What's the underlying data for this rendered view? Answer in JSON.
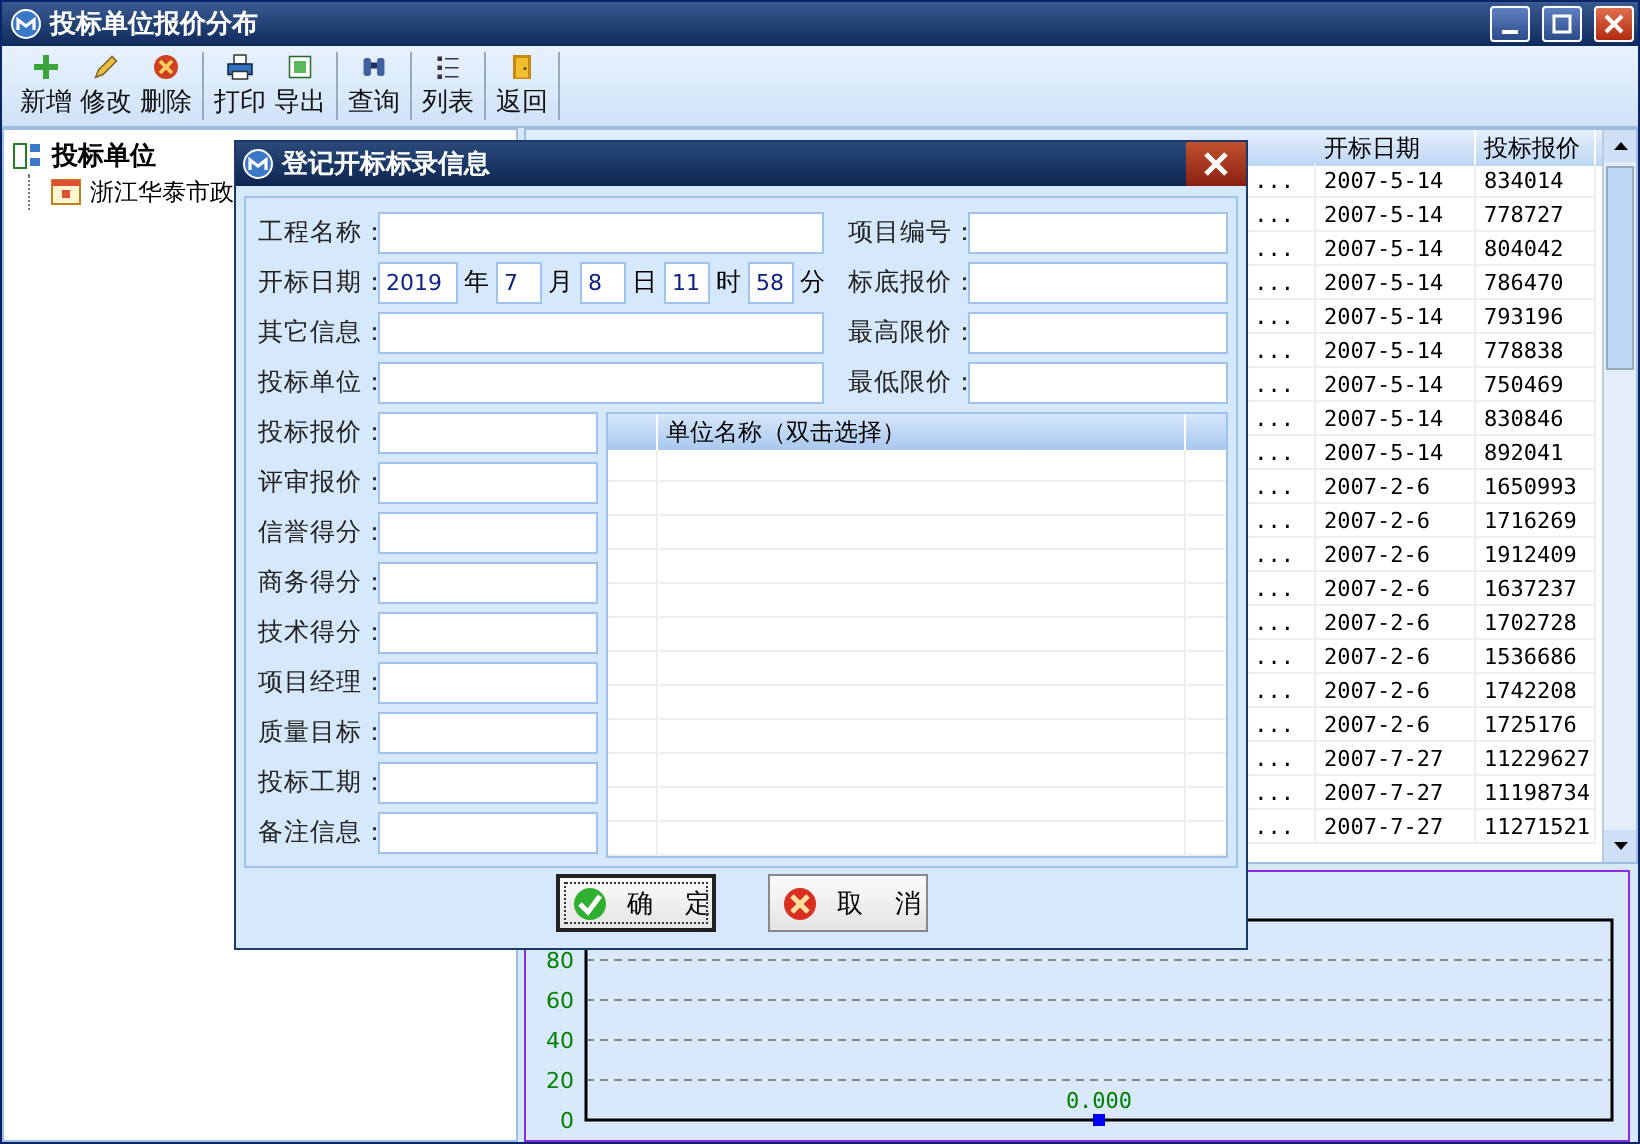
{
  "window": {
    "title": "投标单位报价分布"
  },
  "toolbar": {
    "groups": [
      {
        "buttons": [
          {
            "label": "新增"
          },
          {
            "label": "修改"
          },
          {
            "label": "删除"
          }
        ]
      },
      {
        "buttons": [
          {
            "label": "打印"
          },
          {
            "label": "导出"
          }
        ]
      },
      {
        "buttons": [
          {
            "label": "查询"
          }
        ]
      },
      {
        "buttons": [
          {
            "label": "列表"
          }
        ]
      },
      {
        "buttons": [
          {
            "label": "返回"
          }
        ]
      }
    ]
  },
  "tree": {
    "root": {
      "label": "投标单位",
      "children": [
        {
          "label": "浙江华泰市政"
        }
      ]
    }
  },
  "table": {
    "columns": [
      {
        "label": "开标日期"
      },
      {
        "label": "投标报价"
      }
    ],
    "rows": [
      {
        "project": "...",
        "date": "2007-5-14",
        "price": "834014"
      },
      {
        "project": "...",
        "date": "2007-5-14",
        "price": "778727"
      },
      {
        "project": "...",
        "date": "2007-5-14",
        "price": "804042"
      },
      {
        "project": "...",
        "date": "2007-5-14",
        "price": "786470"
      },
      {
        "project": "...",
        "date": "2007-5-14",
        "price": "793196"
      },
      {
        "project": "...",
        "date": "2007-5-14",
        "price": "778838"
      },
      {
        "project": "...",
        "date": "2007-5-14",
        "price": "750469"
      },
      {
        "project": "...",
        "date": "2007-5-14",
        "price": "830846"
      },
      {
        "project": "...",
        "date": "2007-5-14",
        "price": "892041"
      },
      {
        "project": "...",
        "date": "2007-2-6",
        "price": "1650993"
      },
      {
        "project": "...",
        "date": "2007-2-6",
        "price": "1716269"
      },
      {
        "project": "...",
        "date": "2007-2-6",
        "price": "1912409"
      },
      {
        "project": "...",
        "date": "2007-2-6",
        "price": "1637237"
      },
      {
        "project": "...",
        "date": "2007-2-6",
        "price": "1702728"
      },
      {
        "project": "...",
        "date": "2007-2-6",
        "price": "1536686"
      },
      {
        "project": "...",
        "date": "2007-2-6",
        "price": "1742208"
      },
      {
        "project": "...",
        "date": "2007-2-6",
        "price": "1725176"
      },
      {
        "project": "...",
        "date": "2007-7-27",
        "price": "11229627"
      },
      {
        "project": "...",
        "date": "2007-7-27",
        "price": "11198734"
      },
      {
        "project": "...",
        "date": "2007-7-27",
        "price": "11271521"
      }
    ]
  },
  "chart": {
    "chart_data": {
      "type": "line",
      "categories": [
        null
      ],
      "series": [
        {
          "color": "#0000ff",
          "marker": "square",
          "values": [
            0
          ]
        }
      ],
      "ylim": [
        0,
        100
      ],
      "yticks": [
        0,
        20,
        40,
        60,
        80
      ],
      "grid": true,
      "value_labels": [
        "0.000"
      ]
    }
  },
  "dialog": {
    "title": "登记开标标录信息",
    "left_fields": [
      {
        "label": "工程名称："
      },
      {
        "kind": "date",
        "label": "开标日期：",
        "parts": [
          {
            "value": "2019",
            "unit": "年"
          },
          {
            "value": "7",
            "unit": "月"
          },
          {
            "value": "8",
            "unit": "日"
          },
          {
            "value": "11",
            "unit": "时"
          },
          {
            "value": "58",
            "unit": "分"
          }
        ]
      },
      {
        "label": "其它信息："
      },
      {
        "label": "投标单位："
      }
    ],
    "right_fields": [
      {
        "label": "项目编号："
      },
      {
        "label": "标底报价："
      },
      {
        "label": "最高限价："
      },
      {
        "label": "最低限价："
      }
    ],
    "lower_fields": [
      {
        "label": "投标报价："
      },
      {
        "label": "评审报价："
      },
      {
        "label": "信誉得分："
      },
      {
        "label": "商务得分："
      },
      {
        "label": "技术得分："
      },
      {
        "label": "项目经理："
      },
      {
        "label": "质量目标："
      },
      {
        "label": "投标工期："
      },
      {
        "label": "备注信息："
      }
    ],
    "unit_list": {
      "header": "单位名称（双击选择）"
    },
    "buttons": [
      {
        "kind": "ok",
        "label": "确 定",
        "focused": true
      },
      {
        "kind": "cancel",
        "label": "取 消",
        "focused": false
      }
    ]
  }
}
